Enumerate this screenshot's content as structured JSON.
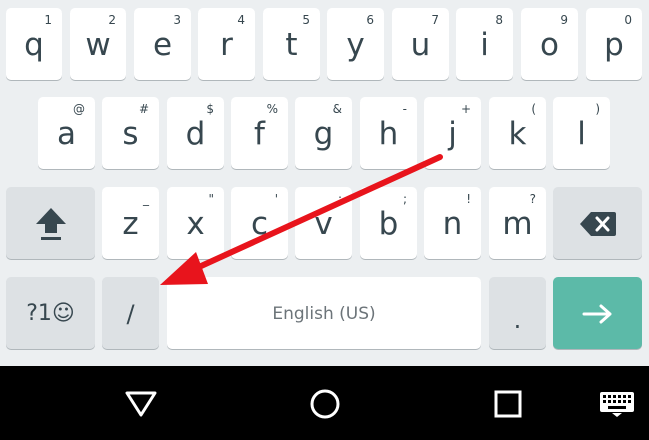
{
  "keyboard": {
    "row1": [
      {
        "key": "q",
        "hint": "1"
      },
      {
        "key": "w",
        "hint": "2"
      },
      {
        "key": "e",
        "hint": "3"
      },
      {
        "key": "r",
        "hint": "4"
      },
      {
        "key": "t",
        "hint": "5"
      },
      {
        "key": "y",
        "hint": "6"
      },
      {
        "key": "u",
        "hint": "7"
      },
      {
        "key": "i",
        "hint": "8"
      },
      {
        "key": "o",
        "hint": "9"
      },
      {
        "key": "p",
        "hint": "0"
      }
    ],
    "row2": [
      {
        "key": "a",
        "hint": "@"
      },
      {
        "key": "s",
        "hint": "#"
      },
      {
        "key": "d",
        "hint": "$"
      },
      {
        "key": "f",
        "hint": "%"
      },
      {
        "key": "g",
        "hint": "&"
      },
      {
        "key": "h",
        "hint": "-"
      },
      {
        "key": "j",
        "hint": "+"
      },
      {
        "key": "k",
        "hint": "("
      },
      {
        "key": "l",
        "hint": ")"
      }
    ],
    "row3": [
      {
        "key": "z",
        "hint": "_"
      },
      {
        "key": "x",
        "hint": "\""
      },
      {
        "key": "c",
        "hint": "'"
      },
      {
        "key": "v",
        "hint": ":"
      },
      {
        "key": "b",
        "hint": ";"
      },
      {
        "key": "n",
        "hint": "!"
      },
      {
        "key": "m",
        "hint": "?"
      }
    ],
    "symbols_label": "?1☺",
    "slash_label": "/",
    "space_label": "English (US)",
    "period_label": ".",
    "shift_icon": "shift-arrow-icon",
    "backspace_icon": "backspace-icon",
    "enter_icon": "right-arrow-icon"
  },
  "navbar": {
    "back_icon": "triangle-back-icon",
    "home_icon": "circle-home-icon",
    "recents_icon": "square-recents-icon",
    "keyboard_icon": "keyboard-icon"
  },
  "annotation": {
    "arrow_color": "#e8141c"
  },
  "colors": {
    "keyboard_bg": "#eceff1",
    "key_bg": "#ffffff",
    "mod_key_bg": "#dde1e4",
    "enter_bg": "#5cbaa8",
    "key_text": "#37474f",
    "navbar_bg": "#000000"
  }
}
